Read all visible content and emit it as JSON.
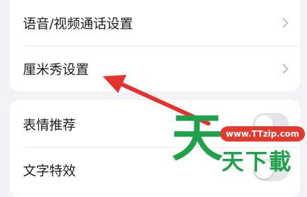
{
  "settings_group_1": {
    "items": [
      {
        "label": "语音/视频通话设置",
        "icon": "chevron-right-icon"
      },
      {
        "label": "厘米秀设置",
        "icon": "chevron-right-icon"
      }
    ]
  },
  "settings_group_2": {
    "items": [
      {
        "label": "表情推荐",
        "control": "toggle"
      },
      {
        "label": "文字特效",
        "control": "toggle"
      }
    ]
  },
  "annotation": {
    "arrow_color": "#e5322d",
    "points_to": "厘米秀设置"
  },
  "watermark": {
    "big_char": "天",
    "badge_text": "www.TTzip.com",
    "small_text": "天下載",
    "green": "#1fa14a",
    "red": "#e23a2e"
  }
}
